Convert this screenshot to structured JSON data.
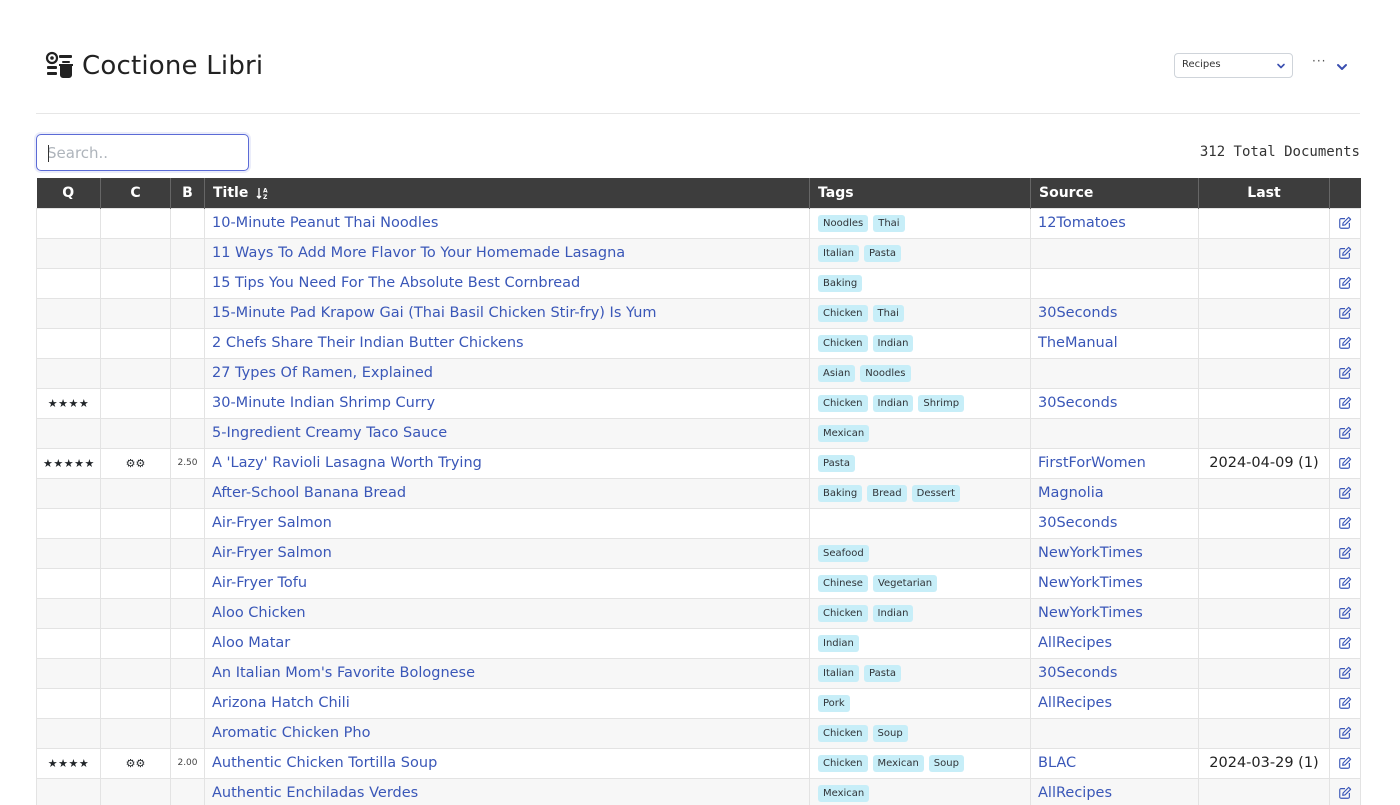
{
  "header": {
    "title": "Coctione Libri",
    "logo_icon": "recipe-logo-icon",
    "collection_select": "Recipes",
    "more_label": "···"
  },
  "search": {
    "placeholder": "Search.."
  },
  "total_documents": "312 Total Documents",
  "table": {
    "columns": [
      "Q",
      "C",
      "B",
      "Title",
      "Tags",
      "Source",
      "Last"
    ],
    "sort_icon": "sort-alpha-down-icon",
    "rows": [
      {
        "q": "",
        "c": "",
        "b": "",
        "title": "10-Minute Peanut Thai Noodles",
        "tags": [
          "Noodles",
          "Thai"
        ],
        "source": "12Tomatoes",
        "last": ""
      },
      {
        "q": "",
        "c": "",
        "b": "",
        "title": "11 Ways To Add More Flavor To Your Homemade Lasagna",
        "tags": [
          "Italian",
          "Pasta"
        ],
        "source": "",
        "last": ""
      },
      {
        "q": "",
        "c": "",
        "b": "",
        "title": "15 Tips You Need For The Absolute Best Cornbread",
        "tags": [
          "Baking"
        ],
        "source": "",
        "last": ""
      },
      {
        "q": "",
        "c": "",
        "b": "",
        "title": "15-Minute Pad Krapow Gai (Thai Basil Chicken Stir-fry) Is Yum",
        "tags": [
          "Chicken",
          "Thai"
        ],
        "source": "30Seconds",
        "last": ""
      },
      {
        "q": "",
        "c": "",
        "b": "",
        "title": "2 Chefs Share Their Indian Butter Chickens",
        "tags": [
          "Chicken",
          "Indian"
        ],
        "source": "TheManual",
        "last": ""
      },
      {
        "q": "",
        "c": "",
        "b": "",
        "title": "27 Types Of Ramen, Explained",
        "tags": [
          "Asian",
          "Noodles"
        ],
        "source": "",
        "last": ""
      },
      {
        "q": "★★★★",
        "c": "",
        "b": "",
        "title": "30-Minute Indian Shrimp Curry",
        "tags": [
          "Chicken",
          "Indian",
          "Shrimp"
        ],
        "source": "30Seconds",
        "last": ""
      },
      {
        "q": "",
        "c": "",
        "b": "",
        "title": "5-Ingredient Creamy Taco Sauce",
        "tags": [
          "Mexican"
        ],
        "source": "",
        "last": ""
      },
      {
        "q": "★★★★★",
        "c": "⚙⚙",
        "b": "2.50",
        "title": "A 'Lazy' Ravioli Lasagna Worth Trying",
        "tags": [
          "Pasta"
        ],
        "source": "FirstForWomen",
        "last": "2024-04-09 (1)"
      },
      {
        "q": "",
        "c": "",
        "b": "",
        "title": "After-School Banana Bread",
        "tags": [
          "Baking",
          "Bread",
          "Dessert"
        ],
        "source": "Magnolia",
        "last": ""
      },
      {
        "q": "",
        "c": "",
        "b": "",
        "title": "Air-Fryer Salmon",
        "tags": [],
        "source": "30Seconds",
        "last": ""
      },
      {
        "q": "",
        "c": "",
        "b": "",
        "title": "Air-Fryer Salmon",
        "tags": [
          "Seafood"
        ],
        "source": "NewYorkTimes",
        "last": ""
      },
      {
        "q": "",
        "c": "",
        "b": "",
        "title": "Air-Fryer Tofu",
        "tags": [
          "Chinese",
          "Vegetarian"
        ],
        "source": "NewYorkTimes",
        "last": ""
      },
      {
        "q": "",
        "c": "",
        "b": "",
        "title": "Aloo Chicken",
        "tags": [
          "Chicken",
          "Indian"
        ],
        "source": "NewYorkTimes",
        "last": ""
      },
      {
        "q": "",
        "c": "",
        "b": "",
        "title": "Aloo Matar",
        "tags": [
          "Indian"
        ],
        "source": "AllRecipes",
        "last": ""
      },
      {
        "q": "",
        "c": "",
        "b": "",
        "title": "An Italian Mom's Favorite Bolognese",
        "tags": [
          "Italian",
          "Pasta"
        ],
        "source": "30Seconds",
        "last": ""
      },
      {
        "q": "",
        "c": "",
        "b": "",
        "title": "Arizona Hatch Chili",
        "tags": [
          "Pork"
        ],
        "source": "AllRecipes",
        "last": ""
      },
      {
        "q": "",
        "c": "",
        "b": "",
        "title": "Aromatic Chicken Pho",
        "tags": [
          "Chicken",
          "Soup"
        ],
        "source": "",
        "last": ""
      },
      {
        "q": "★★★★",
        "c": "⚙⚙",
        "b": "2.00",
        "title": "Authentic Chicken Tortilla Soup",
        "tags": [
          "Chicken",
          "Mexican",
          "Soup"
        ],
        "source": "BLAC",
        "last": "2024-03-29 (1)"
      },
      {
        "q": "",
        "c": "",
        "b": "",
        "title": "Authentic Enchiladas Verdes",
        "tags": [
          "Mexican"
        ],
        "source": "AllRecipes",
        "last": ""
      }
    ]
  },
  "colors": {
    "header_bg": "#3d3d3d",
    "link": "#3a57b8",
    "tag_bg": "#c7eef8",
    "focus": "#5b6bd6"
  }
}
